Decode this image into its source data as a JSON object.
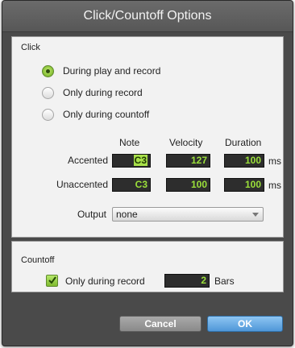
{
  "window": {
    "title": "Click/Countoff Options"
  },
  "click": {
    "section_label": "Click",
    "options": [
      {
        "label": "During play and record",
        "selected": true
      },
      {
        "label": "Only during record",
        "selected": false
      },
      {
        "label": "Only during countoff",
        "selected": false
      }
    ],
    "columns": {
      "note": "Note",
      "velocity": "Velocity",
      "duration": "Duration"
    },
    "rows": {
      "accented": {
        "label": "Accented",
        "note": "C3",
        "velocity": "127",
        "duration": "100",
        "unit": "ms"
      },
      "unaccented": {
        "label": "Unaccented",
        "note": "C3",
        "velocity": "100",
        "duration": "100",
        "unit": "ms"
      }
    },
    "output": {
      "label": "Output",
      "value": "none"
    }
  },
  "countoff": {
    "section_label": "Countoff",
    "only_during_record": {
      "label": "Only during record",
      "checked": true
    },
    "bars": {
      "value": "2",
      "unit": "Bars"
    }
  },
  "buttons": {
    "cancel": "Cancel",
    "ok": "OK"
  },
  "colors": {
    "accent_green": "#9be03a",
    "ok_blue": "#4f97d8"
  }
}
